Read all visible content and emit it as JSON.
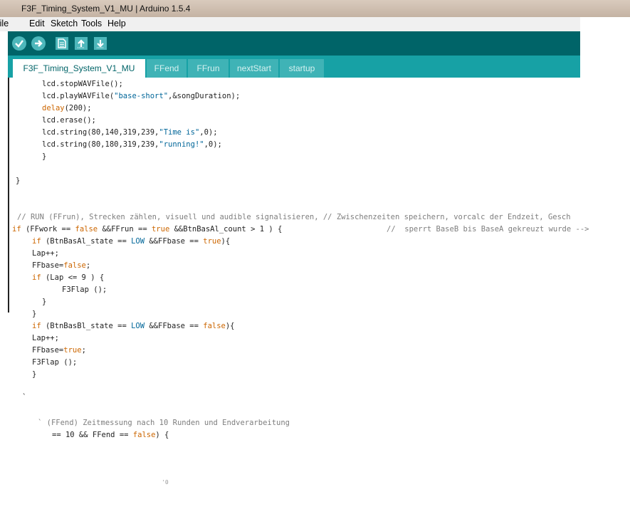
{
  "window": {
    "title": "F3F_Timing_System_V1_MU | Arduino 1.5.4"
  },
  "menu": {
    "file": "File",
    "edit": "Edit",
    "sketch": "Sketch",
    "tools": "Tools",
    "help": "Help"
  },
  "toolbar": {
    "verify_icon": "checkmark-icon",
    "upload_icon": "right-arrow-icon",
    "new_icon": "document-icon",
    "open_icon": "up-arrow-icon",
    "save_icon": "down-arrow-icon"
  },
  "tabs": [
    {
      "label": "F3F_Timing_System_V1_MU"
    },
    {
      "label": "FFend"
    },
    {
      "label": "FFrun"
    },
    {
      "label": "nextStart"
    },
    {
      "label": "startup"
    }
  ],
  "code": {
    "l1": "lcd.stopWAVFile();",
    "l2a": "lcd.playWAVFile(",
    "l2b": "\"base-short\"",
    "l2c": ",&songDuration);",
    "l3a": "delay",
    "l3b": "(200);",
    "l4": "lcd.erase();",
    "l5a": "lcd.string(80,140,319,239,",
    "l5b": "\"Time is\"",
    "l5c": ",0);",
    "l6a": "lcd.string(80,180,319,239,",
    "l6b": "\"running!\"",
    "l6c": ",0);",
    "l7": "}",
    "l8": "}",
    "c1": "// RUN (FFrun), Strecken zählen, visuell und audible signalisieren, // Zwischenzeiten speichern, vorcalc der Endzeit, Gesch",
    "l9a": "if",
    "l9b": " (FFwork == ",
    "l9c": "false",
    "l9d": " &&FFrun == ",
    "l9e": "true",
    "l9f": " &&BtnBasAl_count > 1 ) {",
    "l9g": "//  sperrt BaseB bis BaseA gekreuzt wurde -->",
    "l10a": "if",
    "l10b": " (BtnBasAl_state == ",
    "l10c": "LOW",
    "l10d": " &&FFbase == ",
    "l10e": "true",
    "l10f": "){",
    "l11": "Lap++;",
    "l12a": "FFbase=",
    "l12b": "false",
    "l12c": ";",
    "l13a": "if",
    "l13b": " (Lap <= 9 ) {",
    "l14": "F3Flap ();",
    "l15": "}",
    "l16": "}",
    "l17a": "if",
    "l17b": " (BtnBasBl_state == ",
    "l17c": "LOW",
    "l17d": " &&FFbase == ",
    "l17e": "false",
    "l17f": "){",
    "l18": "Lap++;",
    "l19a": "FFbase=",
    "l19b": "true",
    "l19c": ";",
    "l20": "F3Flap ();",
    "l21": "}",
    "l22": "`",
    "c2": "` (FFend) Zeitmessung nach 10 Runden und Endverarbeitung",
    "l23a": "== 10 && FFend == ",
    "l23b": "false",
    "l23c": ") {",
    "l24": "'0"
  }
}
